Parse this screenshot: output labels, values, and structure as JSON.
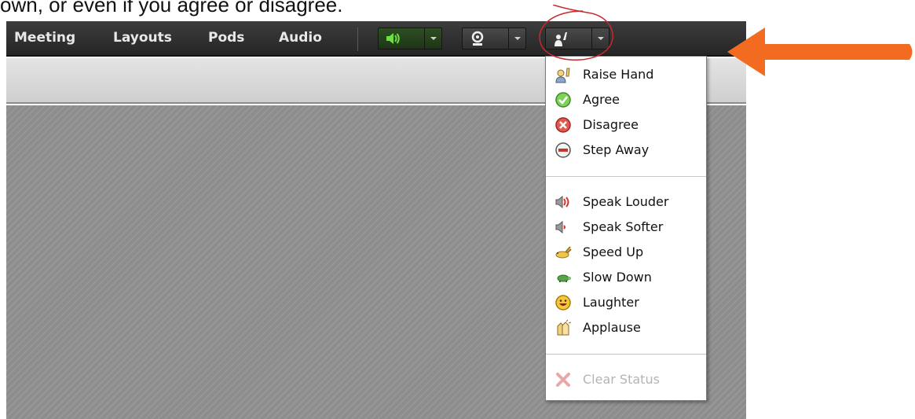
{
  "caption": "own, or even if you agree or disagree.",
  "menubar": {
    "items": [
      "Meeting",
      "Layouts",
      "Pods",
      "Audio"
    ]
  },
  "toolbar": {
    "speaker_icon": "speaker-on-icon",
    "camera_icon": "webcam-icon",
    "status_icon": "raise-hand-icon"
  },
  "status_menu": {
    "groups": [
      [
        {
          "label": "Raise Hand",
          "icon": "raise-hand-icon"
        },
        {
          "label": "Agree",
          "icon": "check-circle-icon"
        },
        {
          "label": "Disagree",
          "icon": "x-circle-icon"
        },
        {
          "label": "Step Away",
          "icon": "minus-circle-icon"
        }
      ],
      [
        {
          "label": "Speak Louder",
          "icon": "speaker-loud-icon"
        },
        {
          "label": "Speak Softer",
          "icon": "speaker-soft-icon"
        },
        {
          "label": "Speed Up",
          "icon": "rabbit-icon"
        },
        {
          "label": "Slow Down",
          "icon": "turtle-icon"
        },
        {
          "label": "Laughter",
          "icon": "smiley-icon"
        },
        {
          "label": "Applause",
          "icon": "clapping-hands-icon"
        }
      ],
      [
        {
          "label": "Clear Status",
          "icon": "clear-x-icon",
          "disabled": true
        }
      ]
    ]
  },
  "colors": {
    "menubar": "#2f2f2f",
    "speaker_green": "#5fd03a",
    "annotation_red": "#c8282e",
    "annotation_arrow": "#f26b21"
  }
}
